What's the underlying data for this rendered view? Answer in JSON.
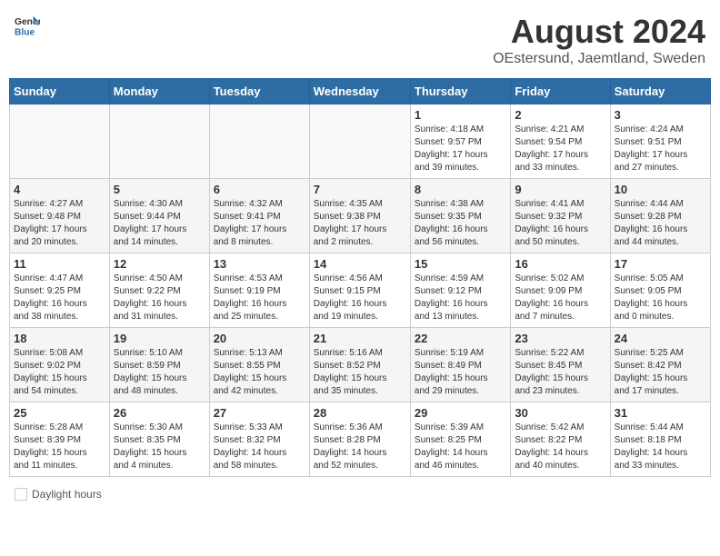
{
  "header": {
    "logo_general": "General",
    "logo_blue": "Blue",
    "month": "August 2024",
    "location": "OEstersund, Jaemtland, Sweden"
  },
  "weekdays": [
    "Sunday",
    "Monday",
    "Tuesday",
    "Wednesday",
    "Thursday",
    "Friday",
    "Saturday"
  ],
  "weeks": [
    [
      {
        "day": "",
        "info": ""
      },
      {
        "day": "",
        "info": ""
      },
      {
        "day": "",
        "info": ""
      },
      {
        "day": "",
        "info": ""
      },
      {
        "day": "1",
        "info": "Sunrise: 4:18 AM\nSunset: 9:57 PM\nDaylight: 17 hours\nand 39 minutes."
      },
      {
        "day": "2",
        "info": "Sunrise: 4:21 AM\nSunset: 9:54 PM\nDaylight: 17 hours\nand 33 minutes."
      },
      {
        "day": "3",
        "info": "Sunrise: 4:24 AM\nSunset: 9:51 PM\nDaylight: 17 hours\nand 27 minutes."
      }
    ],
    [
      {
        "day": "4",
        "info": "Sunrise: 4:27 AM\nSunset: 9:48 PM\nDaylight: 17 hours\nand 20 minutes."
      },
      {
        "day": "5",
        "info": "Sunrise: 4:30 AM\nSunset: 9:44 PM\nDaylight: 17 hours\nand 14 minutes."
      },
      {
        "day": "6",
        "info": "Sunrise: 4:32 AM\nSunset: 9:41 PM\nDaylight: 17 hours\nand 8 minutes."
      },
      {
        "day": "7",
        "info": "Sunrise: 4:35 AM\nSunset: 9:38 PM\nDaylight: 17 hours\nand 2 minutes."
      },
      {
        "day": "8",
        "info": "Sunrise: 4:38 AM\nSunset: 9:35 PM\nDaylight: 16 hours\nand 56 minutes."
      },
      {
        "day": "9",
        "info": "Sunrise: 4:41 AM\nSunset: 9:32 PM\nDaylight: 16 hours\nand 50 minutes."
      },
      {
        "day": "10",
        "info": "Sunrise: 4:44 AM\nSunset: 9:28 PM\nDaylight: 16 hours\nand 44 minutes."
      }
    ],
    [
      {
        "day": "11",
        "info": "Sunrise: 4:47 AM\nSunset: 9:25 PM\nDaylight: 16 hours\nand 38 minutes."
      },
      {
        "day": "12",
        "info": "Sunrise: 4:50 AM\nSunset: 9:22 PM\nDaylight: 16 hours\nand 31 minutes."
      },
      {
        "day": "13",
        "info": "Sunrise: 4:53 AM\nSunset: 9:19 PM\nDaylight: 16 hours\nand 25 minutes."
      },
      {
        "day": "14",
        "info": "Sunrise: 4:56 AM\nSunset: 9:15 PM\nDaylight: 16 hours\nand 19 minutes."
      },
      {
        "day": "15",
        "info": "Sunrise: 4:59 AM\nSunset: 9:12 PM\nDaylight: 16 hours\nand 13 minutes."
      },
      {
        "day": "16",
        "info": "Sunrise: 5:02 AM\nSunset: 9:09 PM\nDaylight: 16 hours\nand 7 minutes."
      },
      {
        "day": "17",
        "info": "Sunrise: 5:05 AM\nSunset: 9:05 PM\nDaylight: 16 hours\nand 0 minutes."
      }
    ],
    [
      {
        "day": "18",
        "info": "Sunrise: 5:08 AM\nSunset: 9:02 PM\nDaylight: 15 hours\nand 54 minutes."
      },
      {
        "day": "19",
        "info": "Sunrise: 5:10 AM\nSunset: 8:59 PM\nDaylight: 15 hours\nand 48 minutes."
      },
      {
        "day": "20",
        "info": "Sunrise: 5:13 AM\nSunset: 8:55 PM\nDaylight: 15 hours\nand 42 minutes."
      },
      {
        "day": "21",
        "info": "Sunrise: 5:16 AM\nSunset: 8:52 PM\nDaylight: 15 hours\nand 35 minutes."
      },
      {
        "day": "22",
        "info": "Sunrise: 5:19 AM\nSunset: 8:49 PM\nDaylight: 15 hours\nand 29 minutes."
      },
      {
        "day": "23",
        "info": "Sunrise: 5:22 AM\nSunset: 8:45 PM\nDaylight: 15 hours\nand 23 minutes."
      },
      {
        "day": "24",
        "info": "Sunrise: 5:25 AM\nSunset: 8:42 PM\nDaylight: 15 hours\nand 17 minutes."
      }
    ],
    [
      {
        "day": "25",
        "info": "Sunrise: 5:28 AM\nSunset: 8:39 PM\nDaylight: 15 hours\nand 11 minutes."
      },
      {
        "day": "26",
        "info": "Sunrise: 5:30 AM\nSunset: 8:35 PM\nDaylight: 15 hours\nand 4 minutes."
      },
      {
        "day": "27",
        "info": "Sunrise: 5:33 AM\nSunset: 8:32 PM\nDaylight: 14 hours\nand 58 minutes."
      },
      {
        "day": "28",
        "info": "Sunrise: 5:36 AM\nSunset: 8:28 PM\nDaylight: 14 hours\nand 52 minutes."
      },
      {
        "day": "29",
        "info": "Sunrise: 5:39 AM\nSunset: 8:25 PM\nDaylight: 14 hours\nand 46 minutes."
      },
      {
        "day": "30",
        "info": "Sunrise: 5:42 AM\nSunset: 8:22 PM\nDaylight: 14 hours\nand 40 minutes."
      },
      {
        "day": "31",
        "info": "Sunrise: 5:44 AM\nSunset: 8:18 PM\nDaylight: 14 hours\nand 33 minutes."
      }
    ]
  ],
  "legend": {
    "daylight_label": "Daylight hours"
  }
}
